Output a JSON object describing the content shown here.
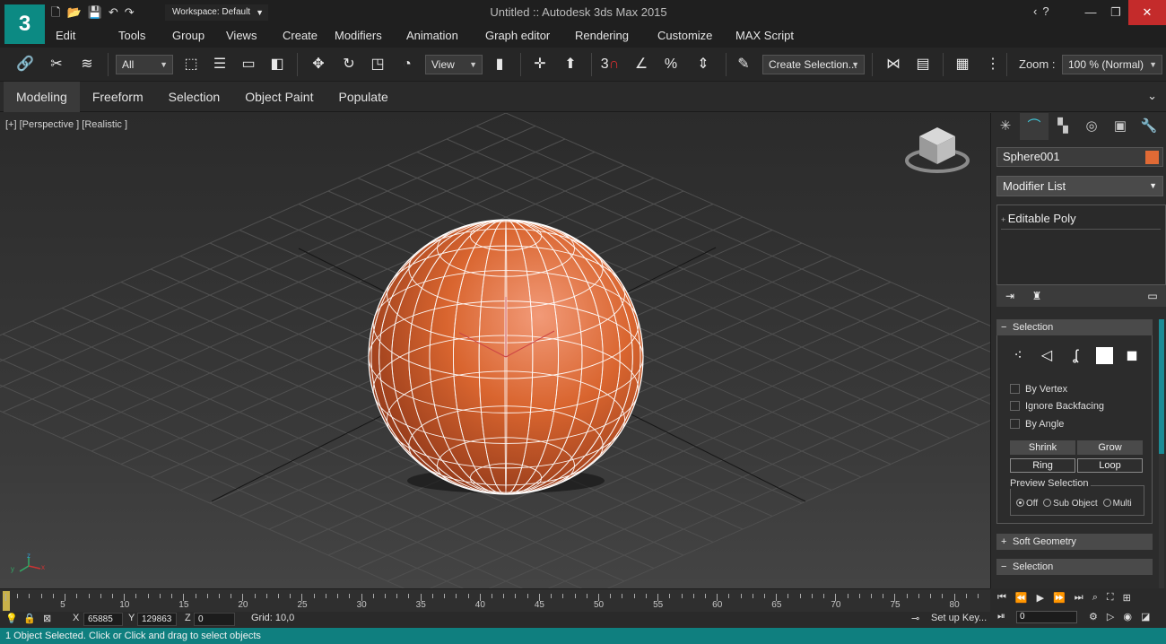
{
  "app": {
    "title": "Untitled :: Autodesk 3ds Max 2015",
    "logo": "3",
    "workspace": "Workspace: Default"
  },
  "menu": [
    "Edit",
    "Tools",
    "Group",
    "Views",
    "Create",
    "Modifiers",
    "Animation",
    "Graph editor",
    "Rendering",
    "Customize",
    "MAX Script"
  ],
  "toolbar": {
    "filter": "All",
    "ref_coord": "View",
    "snap_3": "3",
    "snap_angle": "",
    "create_selection": "Create Selection...",
    "zoom_label": "Zoom :",
    "zoom_value": "100 % (Normal)"
  },
  "ribbon": {
    "tabs": [
      "Modeling",
      "Freeform",
      "Selection",
      "Object Paint",
      "Populate"
    ],
    "active": "Modeling"
  },
  "viewport": {
    "label": "[+] [Perspective ] [Realistic ]",
    "object_color": "#d9652f",
    "axis": {
      "x": "x",
      "y": "y",
      "z": "z"
    }
  },
  "command_panel": {
    "object_name": "Sphere001",
    "object_color": "#e06a35",
    "modifier_list": "Modifier List",
    "stack_item": "Editable Poly",
    "selection_title": "Selection",
    "by_vertex": "By Vertex",
    "ignore_backfacing": "Ignore Backfacing",
    "by_angle": "By Angle",
    "shrink": "Shrink",
    "grow": "Grow",
    "ring": "Ring",
    "loop": "Loop",
    "preview_selection": "Preview Selection",
    "preview_off": "Off",
    "preview_sub": "Sub Object",
    "preview_multi": "Multi",
    "soft_geometry": "Soft Geometry",
    "selection2": "Selection"
  },
  "timeline": {
    "ticks": [
      "5",
      "10",
      "15",
      "20",
      "25",
      "30",
      "35",
      "40",
      "45",
      "50",
      "55",
      "60",
      "65",
      "70",
      "75",
      "80"
    ]
  },
  "status": {
    "x_label": "X",
    "x_value": "65885",
    "y_label": "Y",
    "y_value": "129863",
    "z_label": "Z",
    "z_value": "0",
    "grid": "Grid: 10,0",
    "setup_keys": "Set up Key...",
    "frame": "0",
    "message": "1 Object Selected. Click or Click and drag to select objects"
  }
}
